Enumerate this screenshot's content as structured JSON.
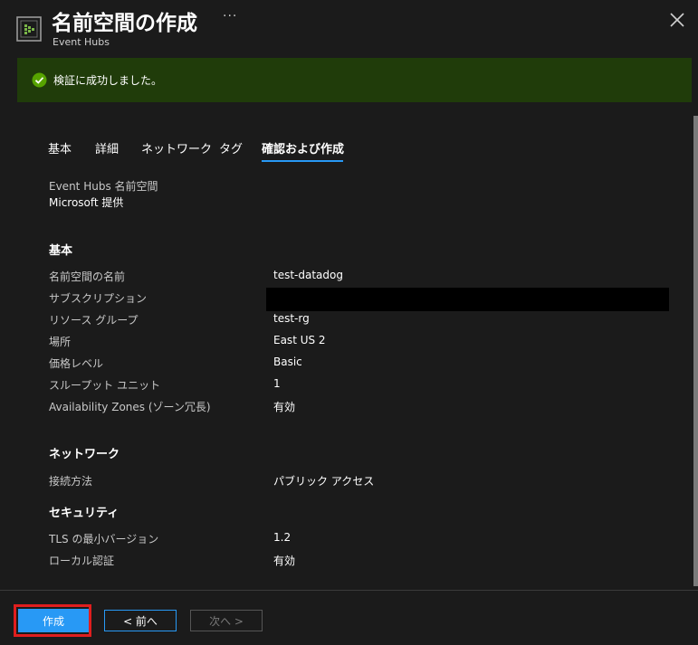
{
  "header": {
    "title": "名前空間の作成",
    "subtitle": "Event Hubs",
    "more": "···"
  },
  "banner": {
    "text": "検証に成功しました。",
    "color": "#203c0a",
    "icon": "check-circle-icon"
  },
  "tabs": [
    {
      "label": "基本"
    },
    {
      "label": "詳細"
    },
    {
      "label": "ネットワーク"
    },
    {
      "label": "タグ"
    },
    {
      "label": "確認および作成",
      "active": true
    }
  ],
  "summary": {
    "heading": "Event Hubs 名前空間",
    "provider": "Microsoft 提供"
  },
  "sections": {
    "basic": {
      "heading": "基本",
      "rows": [
        {
          "label": "名前空間の名前",
          "value": "test-datadog"
        },
        {
          "label": "サブスクリプション",
          "value": ""
        },
        {
          "label": "リソース グループ",
          "value": "test-rg"
        },
        {
          "label": "場所",
          "value": "East US 2"
        },
        {
          "label": "価格レベル",
          "value": "Basic"
        },
        {
          "label": "スループット ユニット",
          "value": "1"
        },
        {
          "label": "Availability Zones (ゾーン冗長)",
          "value": "有効"
        }
      ]
    },
    "network": {
      "heading": "ネットワーク",
      "rows": [
        {
          "label": "接続方法",
          "value": "パブリック アクセス"
        }
      ]
    },
    "security": {
      "heading": "セキュリティ",
      "rows": [
        {
          "label": "TLS の最小バージョン",
          "value": "1.2"
        },
        {
          "label": "ローカル認証",
          "value": "有効"
        }
      ]
    }
  },
  "footer": {
    "create_label": "作成",
    "prev_label": "< 前へ",
    "next_label": "次へ >"
  },
  "colors": {
    "accent": "#2899f5",
    "background": "#1b1b1b",
    "highlight": "#e01e1e"
  }
}
